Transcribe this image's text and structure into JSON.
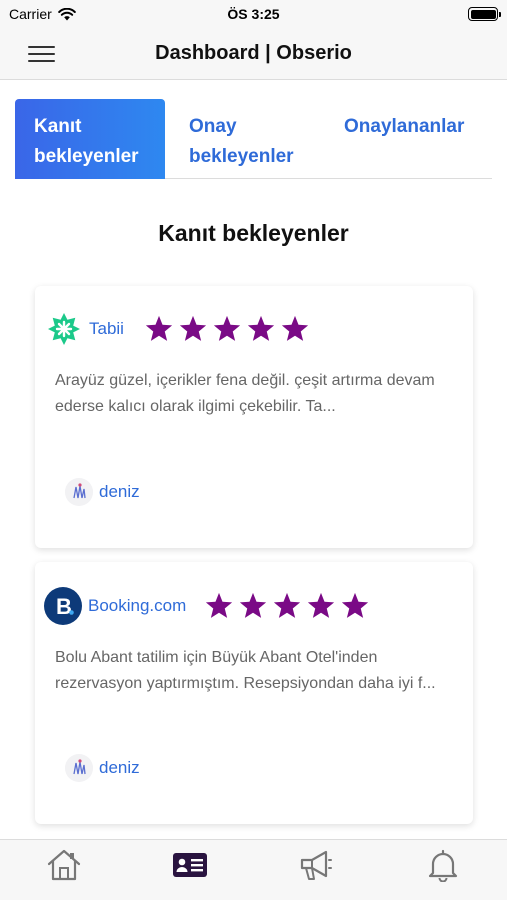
{
  "status_bar": {
    "carrier": "Carrier",
    "time": "ÖS 3:25"
  },
  "nav": {
    "title": "Dashboard | Obserio"
  },
  "tabs": [
    {
      "label": "Kanıt bekleyenler",
      "active": true
    },
    {
      "label": "Onay bekleyenler",
      "active": false
    },
    {
      "label": "Onaylananlar",
      "active": false
    }
  ],
  "section_title": "Kanıt bekleyenler",
  "reviews": [
    {
      "platform": "Tabii",
      "platform_icon": "tabii-logo-icon",
      "rating": 5,
      "text": "Arayüz güzel, içerikler fena değil. çeşit artırma devam ederse kalıcı olarak ilgimi çekebilir. Ta...",
      "author": "deniz"
    },
    {
      "platform": "Booking.com",
      "platform_icon": "booking-logo-icon",
      "rating": 5,
      "text": "Bolu Abant tatilim için Büyük Abant Otel'inden rezervasyon yaptırmıştım. Resepsiyondan daha iyi f...",
      "author": "deniz"
    }
  ],
  "bottom_tabs": [
    {
      "icon": "home-icon",
      "active": false
    },
    {
      "icon": "id-card-icon",
      "active": true
    },
    {
      "icon": "megaphone-icon",
      "active": false
    },
    {
      "icon": "bell-icon",
      "active": false
    }
  ],
  "colors": {
    "accent": "#2f6bd8",
    "tab_gradient_start": "#3a66e8",
    "tab_gradient_end": "#2e88f0",
    "star": "#7a0a86",
    "tabii_green": "#1cc98a",
    "booking_navy": "#0d3a79",
    "active_tab_icon": "#2a1440"
  }
}
